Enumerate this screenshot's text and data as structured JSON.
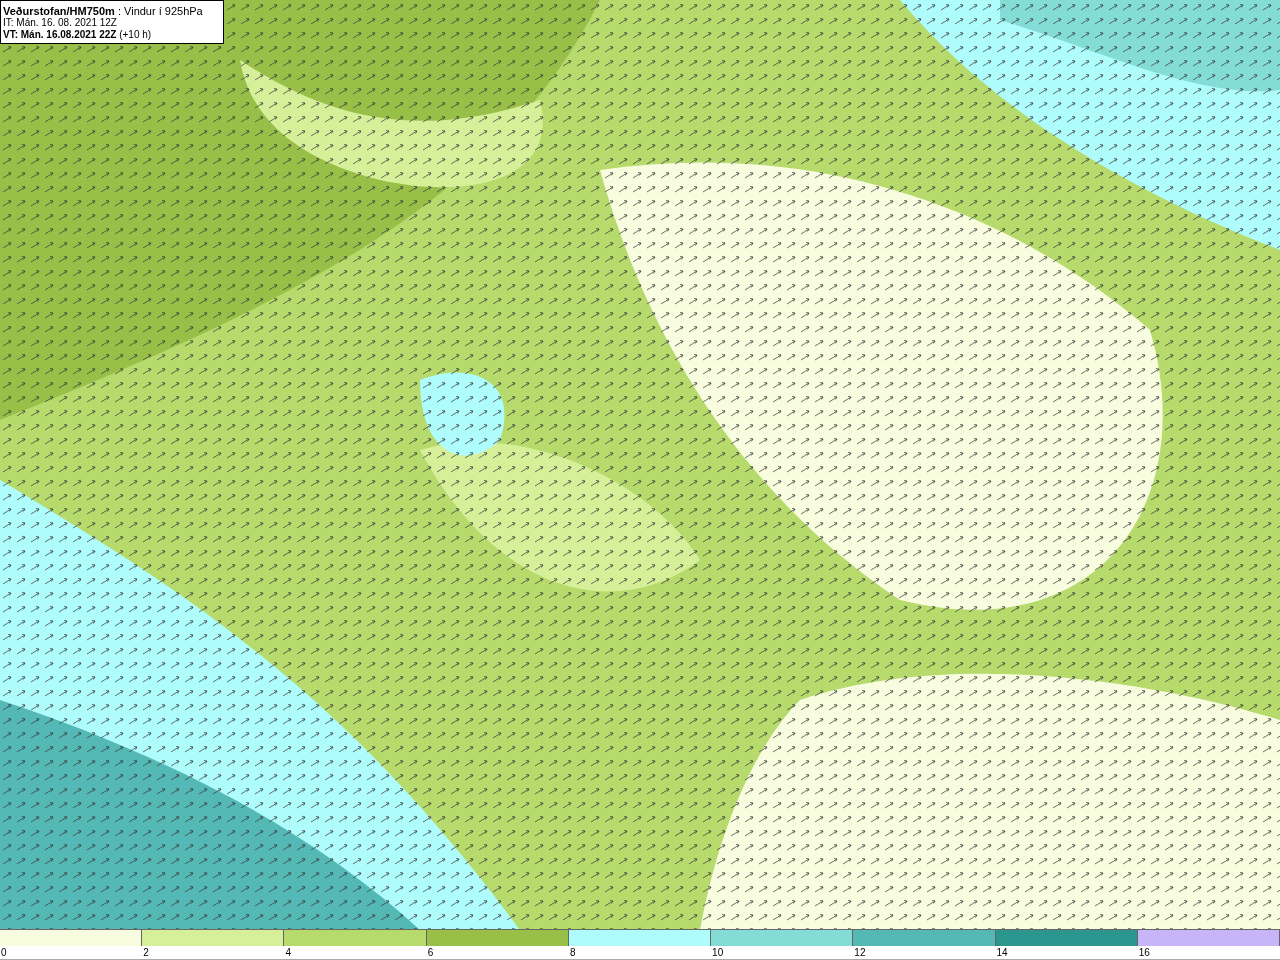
{
  "header": {
    "title": "**Veðurstofan/HM750m** : Vindur í 925hPa",
    "issue_time": "IT: Mán. 16. 08. 2021 12Z",
    "valid_time": "**VT: Mán. 16.08.2021 22Z** (+10 h)"
  },
  "legend": {
    "bins": [
      {
        "color": "#f8fde0"
      },
      {
        "color": "#d6f09a"
      },
      {
        "color": "#b6da6c"
      },
      {
        "color": "#98c048"
      },
      {
        "color": "#aefcfc"
      },
      {
        "color": "#84dcd6"
      },
      {
        "color": "#54b8b4"
      },
      {
        "color": "#2a968e"
      },
      {
        "color": "#c8b4f8"
      }
    ],
    "ticks": [
      "0",
      "2",
      "4",
      "6",
      "8",
      "10",
      "12",
      "14",
      "16"
    ]
  }
}
